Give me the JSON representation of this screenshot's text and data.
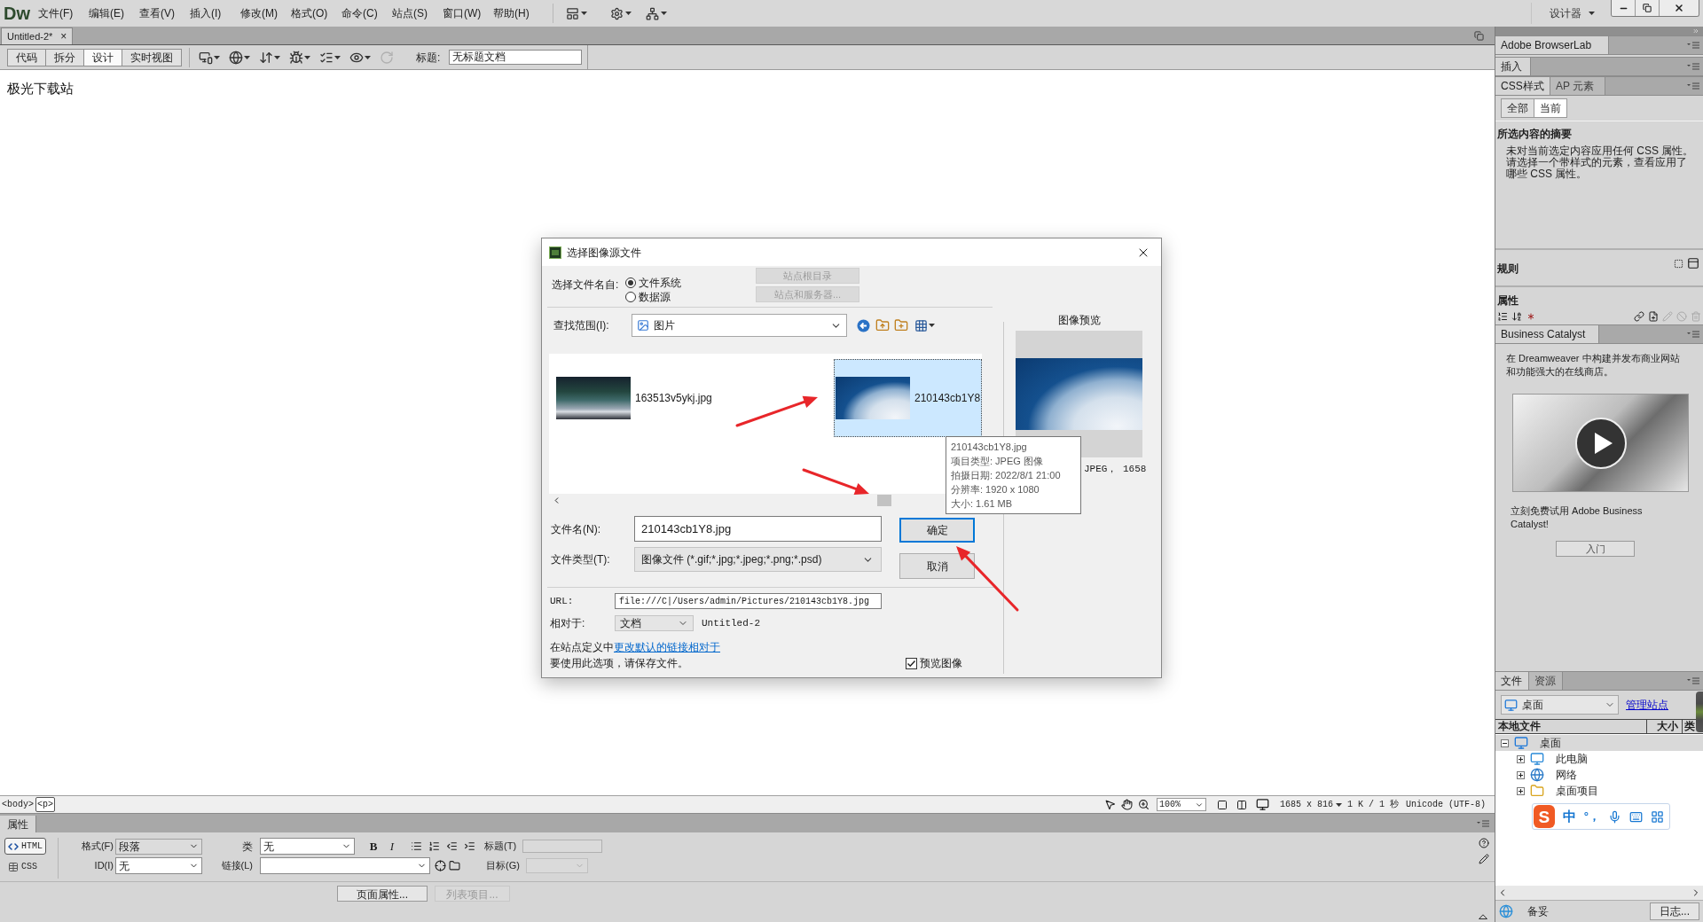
{
  "menu_bar": {
    "logo": "Dw",
    "menus": [
      "文件(F)",
      "编辑(E)",
      "查看(V)",
      "插入(I)",
      "修改(M)",
      "格式(O)",
      "命令(C)",
      "站点(S)",
      "窗口(W)",
      "帮助(H)"
    ],
    "workspace": "设计器"
  },
  "document_tab": {
    "title": "Untitled-2*",
    "close": "×"
  },
  "toolbar": {
    "views": [
      {
        "label": "代码",
        "selected": false
      },
      {
        "label": "拆分",
        "selected": false
      },
      {
        "label": "设计",
        "selected": true
      },
      {
        "label": "实时视图",
        "selected": false
      }
    ],
    "title_label": "标题:",
    "title_value": "无标题文档"
  },
  "design_view": {
    "text": "极光下载站"
  },
  "dialog": {
    "title": "选择图像源文件",
    "source_label": "选择文件名自:",
    "sources": [
      {
        "label": "文件系统",
        "selected": true
      },
      {
        "label": "数据源",
        "selected": false
      }
    ],
    "site_buttons": [
      {
        "label": "站点根目录",
        "disabled": true
      },
      {
        "label": "站点和服务器...",
        "disabled": true
      }
    ],
    "look_in_label": "查找范围(I):",
    "look_in_value": "图片",
    "files": [
      {
        "name": "163513v5ykj.jpg",
        "selected": false
      },
      {
        "name": "210143cb1Y8",
        "selected": true
      }
    ],
    "tooltip": [
      "210143cb1Y8.jpg",
      "项目类型: JPEG 图像",
      "拍摄日期: 2022/8/1 21:00",
      "分辨率: 1920 x 1080",
      "大小: 1.61 MB"
    ],
    "file_name_label": "文件名(N):",
    "file_name_value": "210143cb1Y8.jpg",
    "file_type_label": "文件类型(T):",
    "file_type_value": "图像文件 (*.gif;*.jpg;*.jpeg;*.png;*.psd)",
    "buttons": [
      {
        "label": "确定",
        "default": true
      },
      {
        "label": "取消",
        "default": false
      }
    ],
    "url_label": "URL:",
    "url_value": "file:///C|/Users/admin/Pictures/210143cb1Y8.jpg",
    "relative_label": "相对于:",
    "relative_value": "文档",
    "relative_document": "Untitled-2",
    "note_prefix": "在站点定义中",
    "note_link": "更改默认的链接相对于",
    "note_save": "要使用此选项，请保存文件。",
    "preview_checkbox": {
      "label": "预览图像",
      "checked": true
    },
    "preview_title": "图像预览",
    "preview_info": "JPEG， 1658"
  },
  "status_bar": {
    "tags": [
      {
        "label": "<body>",
        "selected": false
      },
      {
        "label": "<p>",
        "selected": true
      }
    ],
    "zoom": "100%",
    "window_size": "1685 x 816",
    "download": "1 K / 1 秒",
    "encoding": "Unicode (UTF-8)"
  },
  "properties_panel": {
    "tab": "属性",
    "modes": [
      {
        "label": "HTML",
        "selected": true
      },
      {
        "label": "CSS",
        "selected": false
      }
    ],
    "format_label": "格式(F)",
    "format_value": "段落",
    "id_label": "ID(I)",
    "id_value": "无",
    "class_label": "类",
    "class_value": "无",
    "link_label": "链接(L)",
    "bold": "B",
    "italic": "I",
    "title_label": "标题(T)",
    "target_label": "目标(G)",
    "buttons": [
      {
        "label": "页面属性...",
        "disabled": false
      },
      {
        "label": "列表项目...",
        "disabled": true
      }
    ]
  },
  "right_panel": {
    "browserlab_tab": "Adobe BrowserLab",
    "insert_tab": "插入",
    "css_tabs": [
      {
        "label": "CSS样式",
        "selected": true
      },
      {
        "label": "AP 元素",
        "selected": false
      }
    ],
    "css_modes": [
      {
        "label": "全部",
        "selected": false
      },
      {
        "label": "当前",
        "selected": true
      }
    ],
    "summary_title": "所选内容的摘要",
    "summary_text": "未对当前选定内容应用任何 CSS 属性。请选择一个带样式的元素，查看应用了哪些 CSS 属性。",
    "rules_title": "规则",
    "properties_title": "属性",
    "catalyst_tab": "Business Catalyst",
    "catalyst_text": "在 Dreamweaver 中构建并发布商业网站和功能强大的在线商店。",
    "catalyst_cta": "立刻免费试用 Adobe Business Catalyst!",
    "catalyst_button": "入门",
    "files_tabs": [
      {
        "label": "文件",
        "selected": true
      },
      {
        "label": "资源",
        "selected": false
      }
    ],
    "site_value": "桌面",
    "manage_link": "管理站点",
    "columns": [
      "本地文件",
      "大小",
      "类"
    ],
    "tree": [
      {
        "label": "桌面",
        "kind": "desktop",
        "expanded": true,
        "selected": true,
        "children": [
          {
            "label": "此电脑",
            "kind": "computer",
            "expanded": false,
            "selected": false
          },
          {
            "label": "网络",
            "kind": "network",
            "expanded": false,
            "selected": false
          },
          {
            "label": "桌面项目",
            "kind": "folder",
            "expanded": false,
            "selected": false
          }
        ]
      }
    ],
    "status": "备妥",
    "log_button": "日志..."
  },
  "ime_toolbar": {
    "logo": "S",
    "mode": "中",
    "punctuation": "°，"
  }
}
